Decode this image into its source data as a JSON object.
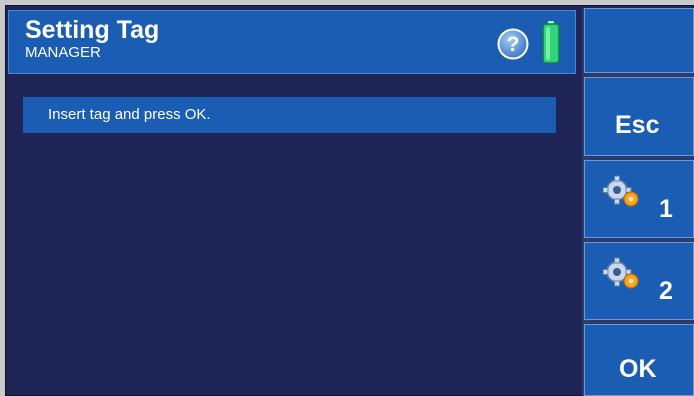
{
  "header": {
    "title": "Setting Tag",
    "subtitle": "MANAGER",
    "help_icon_glyph": "?"
  },
  "message": {
    "text": "Insert tag and press OK."
  },
  "side_buttons": {
    "blank": "",
    "esc": "Esc",
    "option1": "1",
    "option2": "2",
    "ok": "OK"
  },
  "icons": {
    "help": "help-icon",
    "battery": "battery-icon",
    "settings": "gear-icon"
  },
  "colors": {
    "panel_blue": "#1c5db4",
    "background": "#1e2456",
    "battery_green": "#2fd47a"
  }
}
